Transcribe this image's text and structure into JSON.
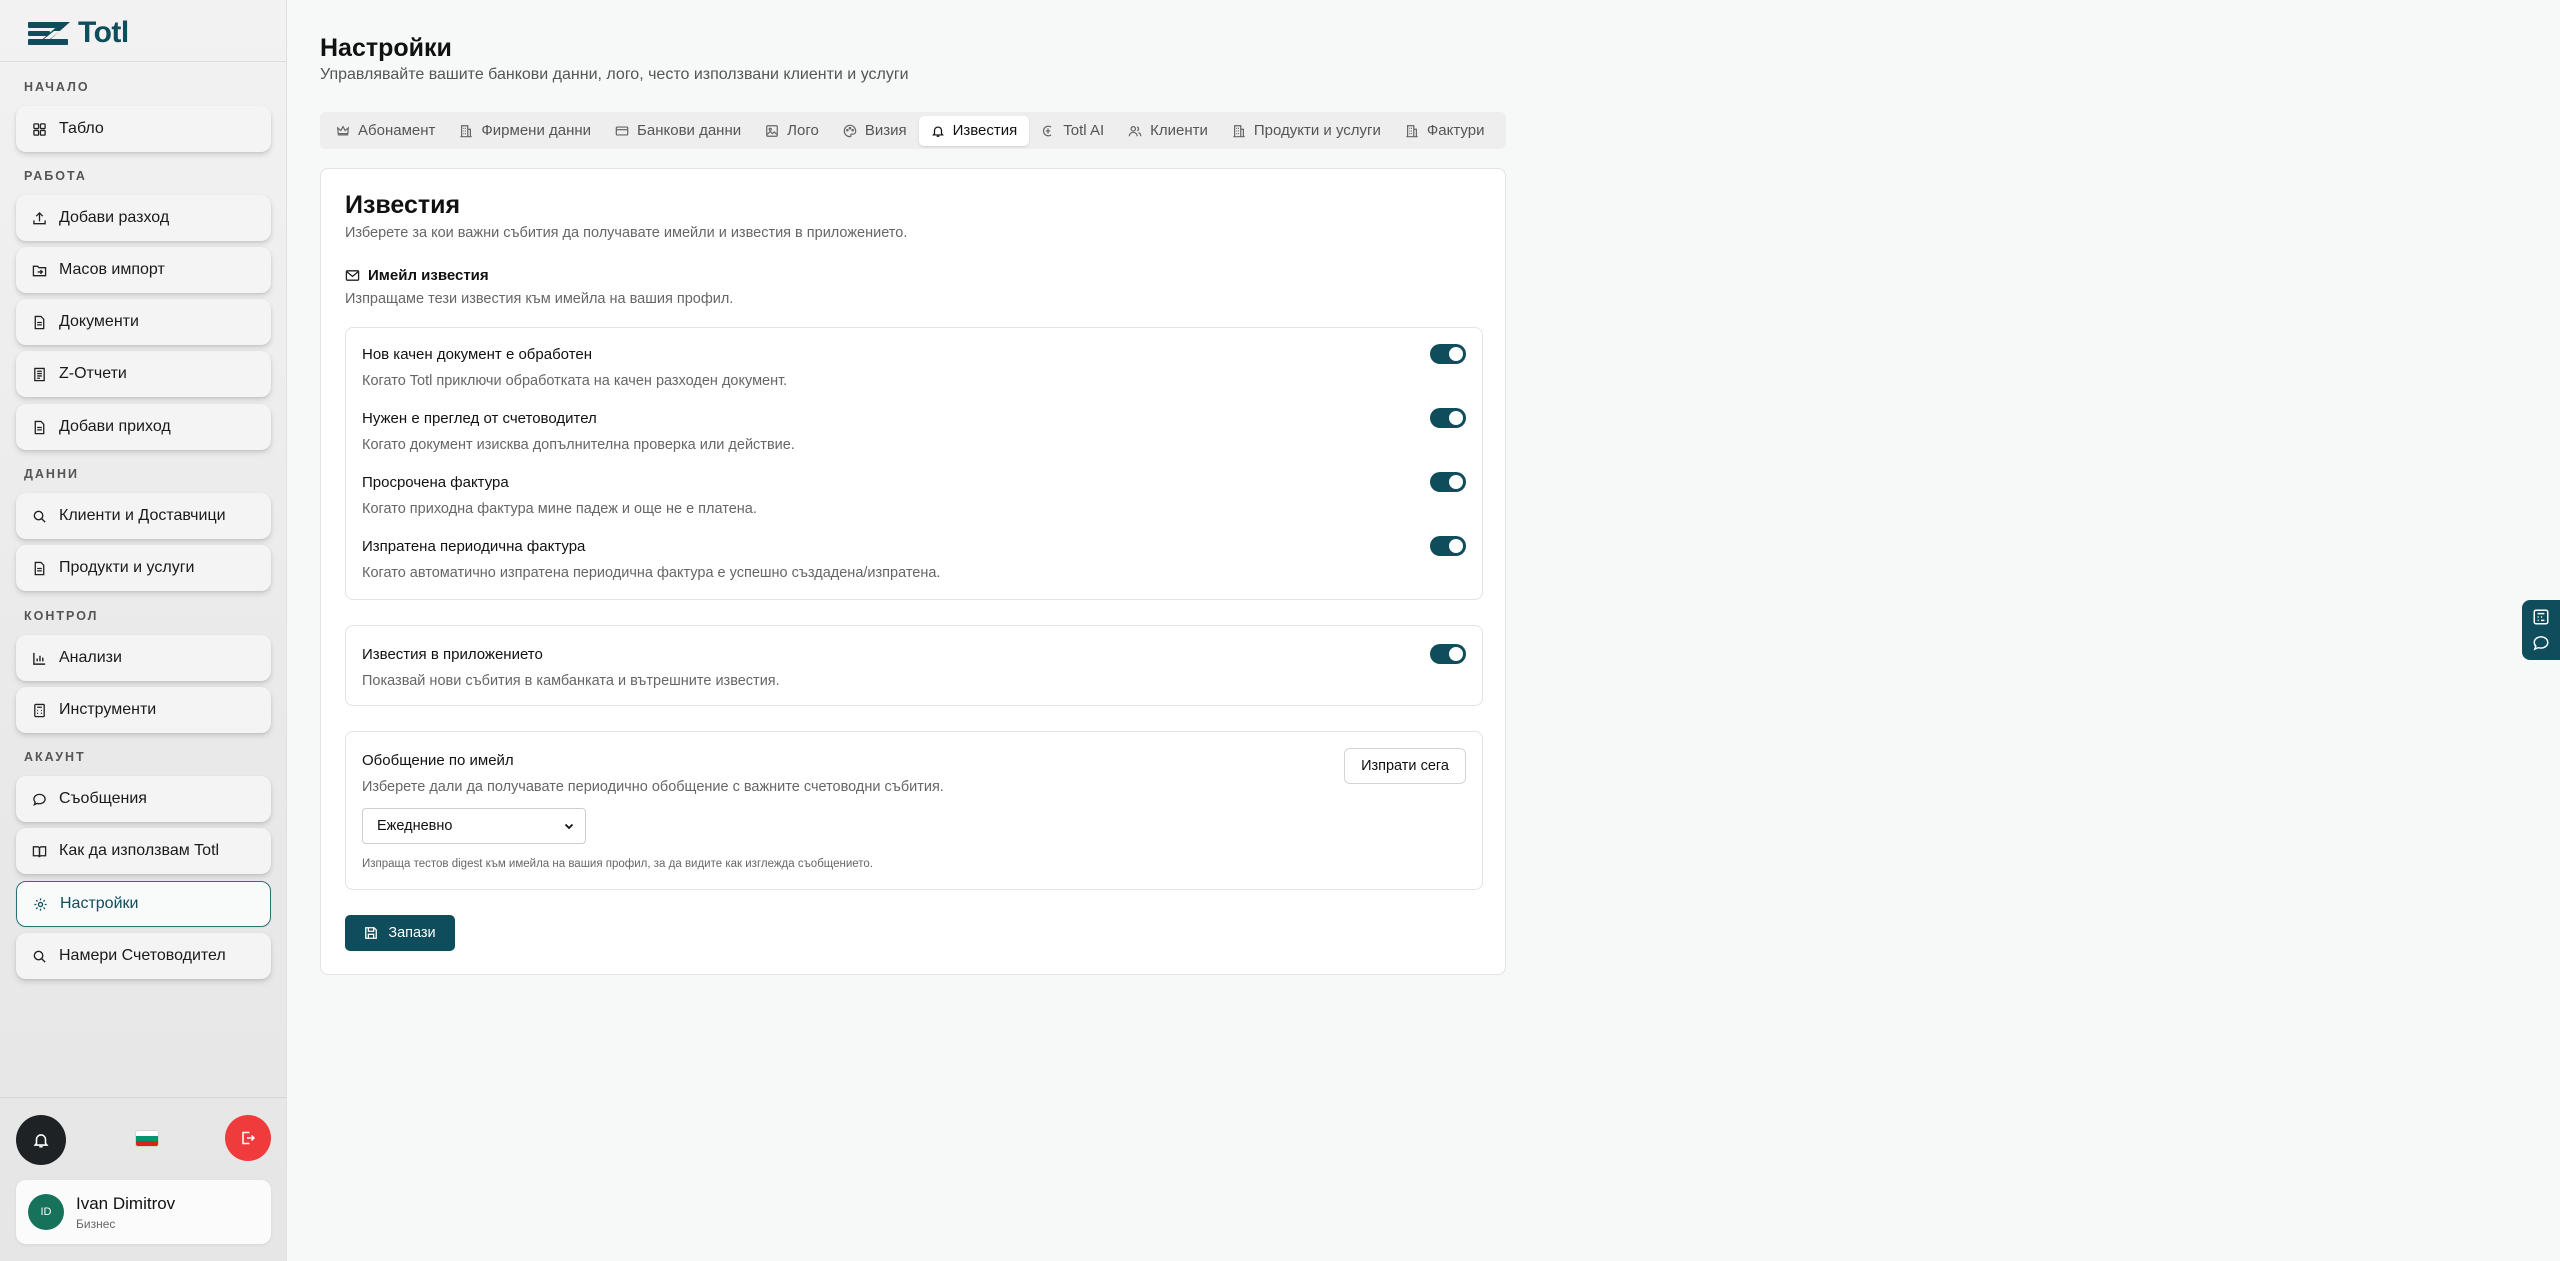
{
  "app": {
    "name": "Totl"
  },
  "sidebar": {
    "sections": [
      {
        "title": "НАЧАЛО"
      },
      {
        "title": "РАБОТА"
      },
      {
        "title": "ДАННИ"
      },
      {
        "title": "КОНТРОЛ"
      },
      {
        "title": "АКАУНТ"
      }
    ],
    "items": [
      {
        "label": "Табло",
        "icon": "dashboard-icon"
      },
      {
        "label": "Добави разход",
        "icon": "upload-icon"
      },
      {
        "label": "Масов импорт",
        "icon": "folder-import-icon"
      },
      {
        "label": "Документи",
        "icon": "document-icon"
      },
      {
        "label": "Z-Отчети",
        "icon": "receipt-icon"
      },
      {
        "label": "Добави приход",
        "icon": "document-icon"
      },
      {
        "label": "Клиенти и Доставчици",
        "icon": "search-icon"
      },
      {
        "label": "Продукти и услуги",
        "icon": "document-icon"
      },
      {
        "label": "Анализи",
        "icon": "bar-chart-icon"
      },
      {
        "label": "Инструменти",
        "icon": "calculator-icon"
      },
      {
        "label": "Съобщения",
        "icon": "message-icon"
      },
      {
        "label": "Как да използвам Totl",
        "icon": "book-icon"
      },
      {
        "label": "Настройки",
        "icon": "gear-icon",
        "active": true
      },
      {
        "label": "Намери Счетоводител",
        "icon": "search-icon"
      }
    ],
    "language_flag": "bg",
    "profile": {
      "initials": "ID",
      "name": "Ivan Dimitrov",
      "plan": "Бизнес"
    }
  },
  "header": {
    "title": "Настройки",
    "subtitle": "Управлявайте вашите банкови данни, лого, често използвани клиенти и услуги"
  },
  "tabs": [
    {
      "label": "Абонамент",
      "icon": "crown-icon"
    },
    {
      "label": "Фирмени данни",
      "icon": "building-icon"
    },
    {
      "label": "Банкови данни",
      "icon": "credit-card-icon"
    },
    {
      "label": "Лого",
      "icon": "image-icon"
    },
    {
      "label": "Визия",
      "icon": "palette-icon"
    },
    {
      "label": "Известия",
      "icon": "bell-icon",
      "active": true
    },
    {
      "label": "Totl AI",
      "icon": "ai-icon"
    },
    {
      "label": "Клиенти",
      "icon": "users-icon"
    },
    {
      "label": "Продукти и услуги",
      "icon": "building-icon"
    },
    {
      "label": "Фактури",
      "icon": "building-icon"
    }
  ],
  "notifications": {
    "title": "Известия",
    "description": "Изберете за кои важни събития да получавате имейли и известия в приложението.",
    "email_section": {
      "title": "Имейл известия",
      "subtitle": "Изпращаме тези известия към имейла на вашия профил.",
      "options": [
        {
          "title": "Нов качен документ е обработен",
          "desc": "Когато Totl приключи обработката на качен разходен документ.",
          "enabled": true
        },
        {
          "title": "Нужен е преглед от счетоводител",
          "desc": "Когато документ изисква допълнителна проверка или действие.",
          "enabled": true
        },
        {
          "title": "Просрочена фактура",
          "desc": "Когато приходна фактура мине падеж и още не е платена.",
          "enabled": true
        },
        {
          "title": "Изпратена периодична фактура",
          "desc": "Когато автоматично изпратена периодична фактура е успешно създадена/изпратена.",
          "enabled": true
        }
      ]
    },
    "in_app": {
      "title": "Известия в приложението",
      "desc": "Показвай нови събития в камбанката и вътрешните известия.",
      "enabled": true
    },
    "digest": {
      "title": "Обобщение по имейл",
      "desc": "Изберете дали да получавате периодично обобщение с важните счетоводни събития.",
      "send_now_label": "Изпрати сега",
      "frequency_selected": "Ежедневно",
      "hint": "Изпраща тестов digest към имейла на вашия профил, за да видите как изглежда съобщението."
    },
    "save_label": "Запази"
  },
  "colors": {
    "accent": "#0f4c5c",
    "logout": "#ef3b3b",
    "avatar": "#16725a"
  }
}
